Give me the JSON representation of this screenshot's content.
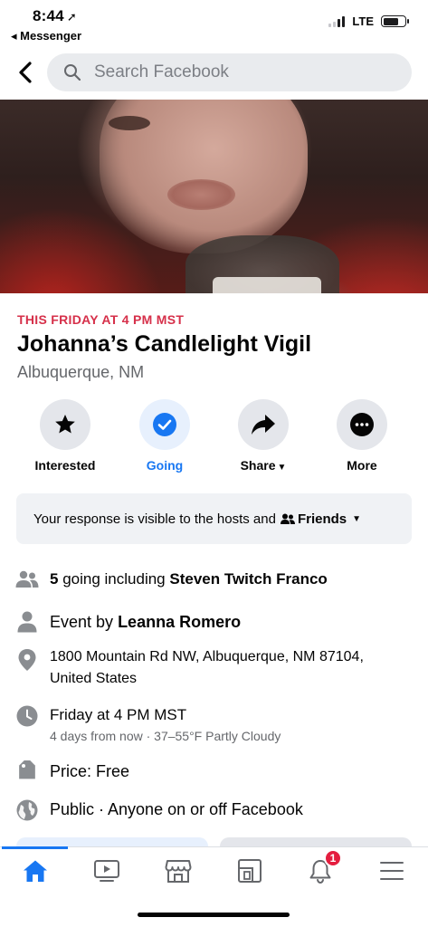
{
  "status_bar": {
    "time": "8:44",
    "back_app": "◂ Messenger",
    "network": "LTE"
  },
  "search": {
    "placeholder": "Search Facebook"
  },
  "event": {
    "date_line": "THIS FRIDAY AT 4 PM MST",
    "title": "Johanna’s Candlelight Vigil",
    "location": "Albuquerque, NM"
  },
  "actions": {
    "interested": "Interested",
    "going": "Going",
    "share": "Share",
    "more": "More"
  },
  "visibility": {
    "text": "Your response is visible to the hosts and",
    "audience": "Friends"
  },
  "details": {
    "going_count": "5",
    "going_text": "going including",
    "going_person": "Steven Twitch Franco",
    "host_prefix": "Event by",
    "host_name": "Leanna Romero",
    "address_line1": "1800 Mountain Rd NW, Albuquerque, NM 87104,",
    "address_line2": "United States",
    "time": "Friday at 4 PM MST",
    "time_sub": "4 days from now · 37–55°F Partly Cloudy",
    "price": "Price: Free",
    "privacy": "Public · Anyone on or off Facebook"
  },
  "tab_bar": {
    "notifications_badge": "1",
    "active_tab": "home"
  },
  "colors": {
    "accent": "#1877f2",
    "date_red": "#d6304a",
    "badge_red": "#e41e3f"
  },
  "icons": {
    "back": "chevron-left-icon",
    "search": "search-icon",
    "interested": "star-icon",
    "going": "check-circle-icon",
    "share": "share-arrow-icon",
    "more": "ellipsis-icon",
    "friends": "friends-icon",
    "people": "people-icon",
    "person": "person-icon",
    "location": "location-pin-icon",
    "clock": "clock-icon",
    "tag": "price-tag-icon",
    "globe": "globe-icon",
    "home": "home-icon",
    "watch": "video-icon",
    "marketplace": "marketplace-icon",
    "pages": "pages-icon",
    "bell": "bell-icon",
    "menu": "menu-icon"
  }
}
